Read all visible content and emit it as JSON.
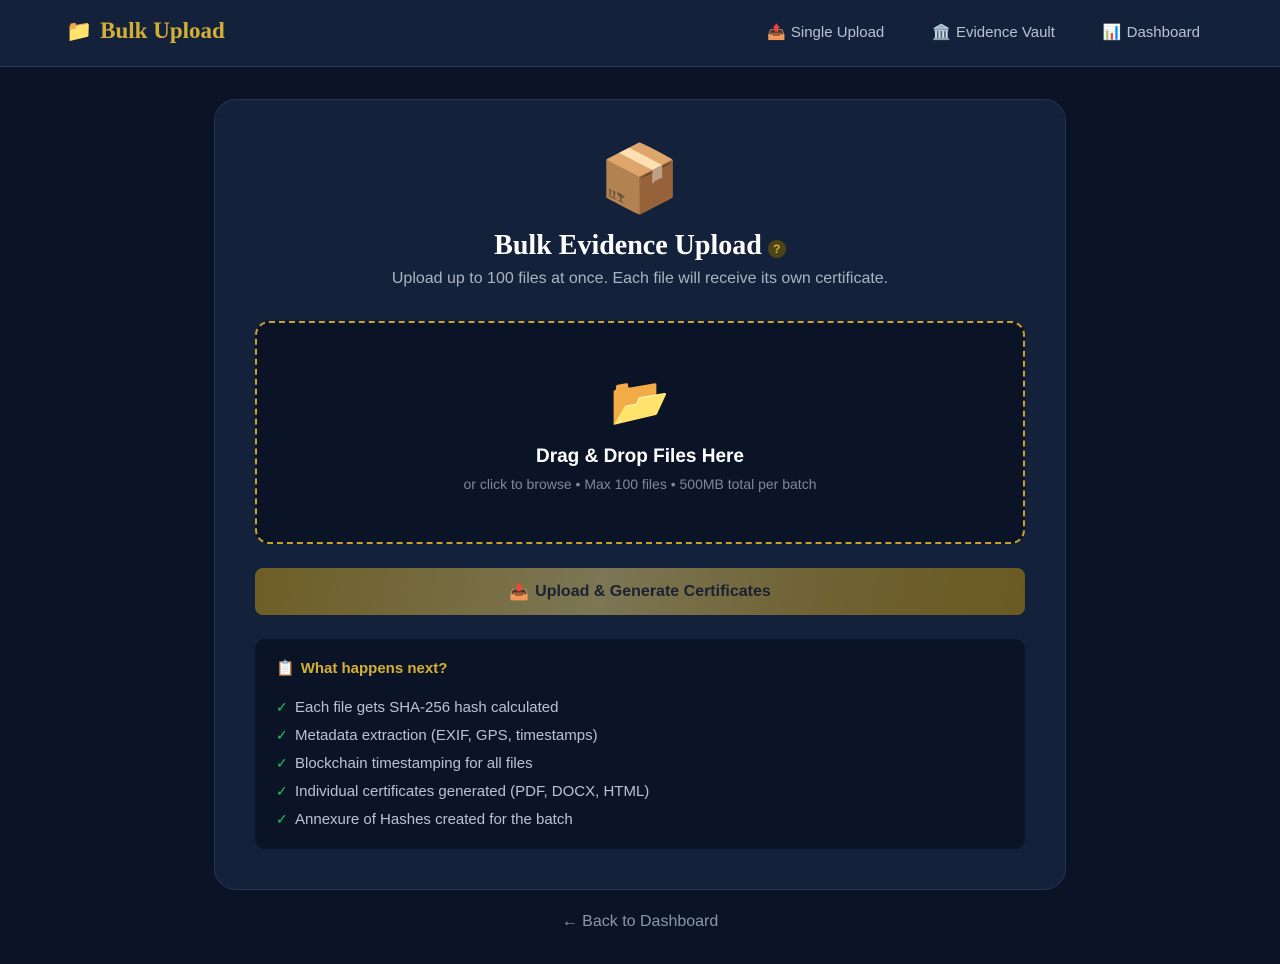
{
  "nav": {
    "brand_icon": "📁",
    "brand": "Bulk Upload",
    "links": [
      {
        "icon": "📤",
        "label": "Single Upload"
      },
      {
        "icon": "🏛️",
        "label": "Evidence Vault"
      },
      {
        "icon": "📊",
        "label": "Dashboard"
      }
    ]
  },
  "main": {
    "hero_icon": "📦",
    "title": "Bulk Evidence Upload",
    "help_icon": "?",
    "subtitle": "Upload up to 100 files at once. Each file will receive its own certificate.",
    "dropzone": {
      "icon": "📂",
      "title": "Drag & Drop Files Here",
      "hint": "or click to browse • Max 100 files • 500MB total per batch"
    },
    "upload_button": {
      "icon": "📤",
      "label": "Upload & Generate Certificates"
    },
    "next_steps": {
      "icon": "📋",
      "title": "What happens next?",
      "check": "✓",
      "items": [
        "Each file gets SHA-256 hash calculated",
        "Metadata extraction (EXIF, GPS, timestamps)",
        "Blockchain timestamping for all files",
        "Individual certificates generated (PDF, DOCX, HTML)",
        "Annexure of Hashes created for the batch"
      ]
    }
  },
  "footer": {
    "back_link": "← Back to Dashboard"
  },
  "colors": {
    "accent": "#d4af37",
    "background": "#0b1426",
    "card": "#14213a",
    "check": "#22c55e"
  }
}
